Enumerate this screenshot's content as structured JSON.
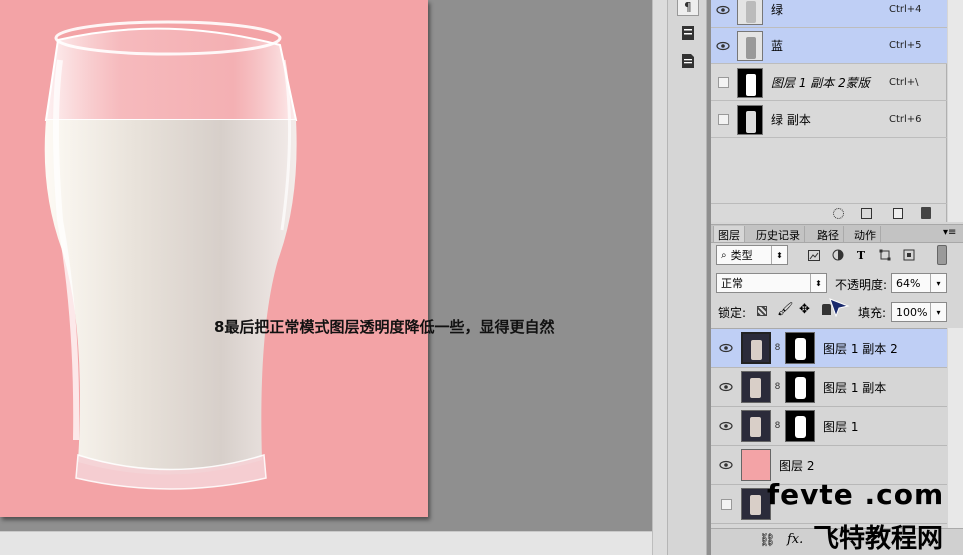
{
  "document": {
    "caption": "8最后把正常模式图层透明度降低一些，显得更自然"
  },
  "channels": [
    {
      "name": "绿",
      "shortcut": "Ctrl+4",
      "visible": true,
      "selected": true
    },
    {
      "name": "蓝",
      "shortcut": "Ctrl+5",
      "visible": true,
      "selected": true
    },
    {
      "name": "图层 1 副本 2蒙版",
      "shortcut": "Ctrl+\\",
      "visible": false,
      "selected": false
    },
    {
      "name": "绿 副本",
      "shortcut": "Ctrl+6",
      "visible": false,
      "selected": false
    }
  ],
  "layers_panel": {
    "tabs": [
      "图层",
      "历史记录",
      "路径",
      "动作"
    ],
    "filter_type": "类型",
    "blend_mode": "正常",
    "opacity_label": "不透明度:",
    "opacity_value": "64%",
    "lock_label": "锁定:",
    "fill_label": "填充:",
    "fill_value": "100%",
    "layers": [
      {
        "name": "图层 1 副本 2",
        "visible": true,
        "selected": true,
        "has_mask": true
      },
      {
        "name": "图层 1 副本",
        "visible": true,
        "selected": false,
        "has_mask": true
      },
      {
        "name": "图层 1",
        "visible": true,
        "selected": false,
        "has_mask": true
      },
      {
        "name": "图层 2",
        "visible": true,
        "selected": false,
        "has_mask": false
      },
      {
        "name": "",
        "visible": false,
        "selected": false,
        "has_mask": false
      }
    ],
    "footer_icons": [
      "link-icon",
      "fx-icon"
    ]
  },
  "watermark": {
    "site": "fevte .com",
    "site_cn": "飞特教程网"
  },
  "colors": {
    "canvas_bg": "#f3a3a6",
    "selection": "#bfcff5",
    "workspace": "#8f8f8f",
    "panel": "#d6d6d6"
  }
}
